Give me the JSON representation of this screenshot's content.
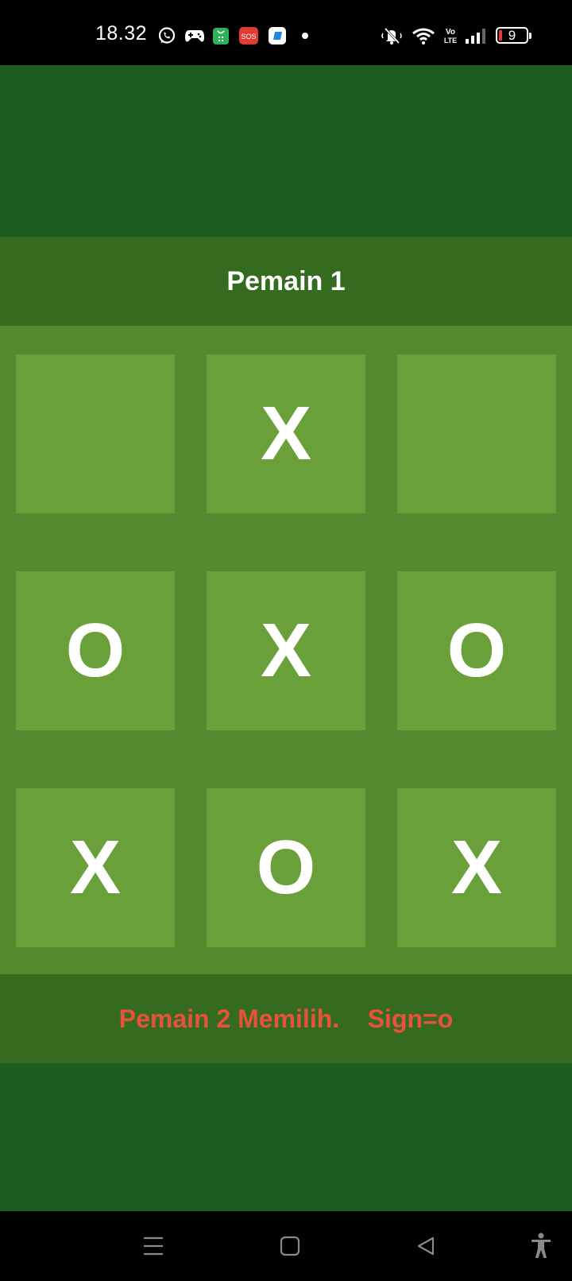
{
  "status_bar": {
    "time": "18.32",
    "battery_level": "9",
    "icons": [
      "whatsapp-icon",
      "gamepad-icon",
      "shopping-bag-icon",
      "sos-icon",
      "app-icon",
      "notification-dot",
      "mute-icon",
      "wifi-icon",
      "volte-icon",
      "signal-icon",
      "battery-icon"
    ],
    "sos_label": "SOS",
    "volte_label_top": "Vo",
    "volte_label_bottom": "LTE"
  },
  "game": {
    "player_title": "Pemain 1",
    "status_message": "Pemain 2 Memilih.    Sign=o",
    "board": [
      [
        "",
        "X",
        ""
      ],
      [
        "O",
        "X",
        "O"
      ],
      [
        "X",
        "O",
        "X"
      ]
    ]
  },
  "nav_bar": {
    "icons": [
      "menu-icon",
      "home-icon",
      "back-icon",
      "accessibility-icon"
    ]
  },
  "colors": {
    "background": "#1d5e20",
    "band": "#356b1f",
    "board": "#558b2f",
    "cell": "#6aa03a",
    "status_text": "#e8513a",
    "battery_low": "#e53935"
  }
}
